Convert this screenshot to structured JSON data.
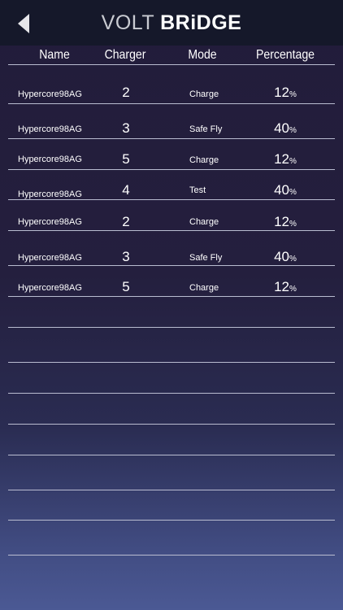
{
  "app": {
    "logo_part1": "VOLT",
    "logo_part2": "BRiDGE"
  },
  "icons": {
    "back": "back-arrow-icon"
  },
  "table": {
    "headers": {
      "name": "Name",
      "charger": "Charger",
      "mode": "Mode",
      "percentage": "Percentage"
    },
    "rows": [
      {
        "name": "Hypercore98AG",
        "charger": "2",
        "mode": "Charge",
        "percentage": "12",
        "unit": "%"
      },
      {
        "name": "Hypercore98AG",
        "charger": "3",
        "mode": "Safe Fly",
        "percentage": "40",
        "unit": "%"
      },
      {
        "name": "Hypercore98AG",
        "charger": "5",
        "mode": "Charge",
        "percentage": "12",
        "unit": "%"
      },
      {
        "name": "Hypercore98AG",
        "charger": "4",
        "mode": "Test",
        "percentage": "40",
        "unit": "%"
      },
      {
        "name": "Hypercore98AG",
        "charger": "2",
        "mode": "Charge",
        "percentage": "12",
        "unit": "%"
      },
      {
        "name": "Hypercore98AG",
        "charger": "3",
        "mode": "Safe Fly",
        "percentage": "40",
        "unit": "%"
      },
      {
        "name": "Hypercore98AG",
        "charger": "5",
        "mode": "Charge",
        "percentage": "12",
        "unit": "%"
      }
    ]
  },
  "colors": {
    "navbar": "#15182a",
    "background_top": "#221c3a",
    "background_bottom": "#4b5994",
    "divider": "#b9bcd0"
  }
}
